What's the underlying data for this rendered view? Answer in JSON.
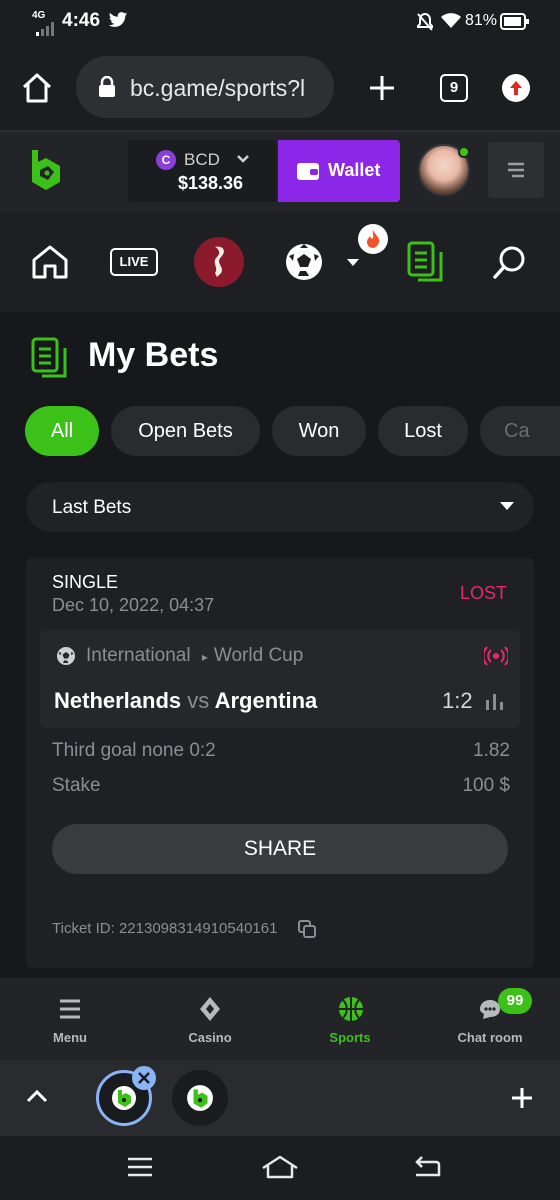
{
  "status_bar": {
    "time": "4:46",
    "network": "4G",
    "battery": "81%"
  },
  "browser": {
    "url": "bc.game/sports?l",
    "tab_count": "9"
  },
  "header": {
    "currency": "BCD",
    "balance": "$138.36",
    "wallet_label": "Wallet",
    "brand_color": "#3bc117",
    "wallet_color": "#8d27e8"
  },
  "nav_icons": [
    "home-icon",
    "live-icon",
    "world-cup-icon",
    "soccer-ball-icon",
    "chevron-down-icon",
    "fire-icon",
    "my-bets-icon",
    "search-icon"
  ],
  "nav": {
    "live_label": "LIVE"
  },
  "page": {
    "title": "My Bets"
  },
  "filters": [
    "All",
    "Open Bets",
    "Won",
    "Lost",
    "Ca"
  ],
  "dropdown": {
    "selected": "Last Bets"
  },
  "bet": {
    "type": "SINGLE",
    "date": "Dec 10, 2022, 04:37",
    "status": "LOST",
    "league": "International",
    "tournament": "World Cup",
    "home": "Netherlands",
    "vs": "vs",
    "away": "Argentina",
    "score": "1:2",
    "selection": "Third goal none  0:2",
    "odds": "1.82",
    "stake_label": "Stake",
    "stake_value": "100 $",
    "share_label": "SHARE",
    "ticket": "Ticket ID: 2213098314910540161"
  },
  "bottom_nav": {
    "items": [
      {
        "label": "Menu"
      },
      {
        "label": "Casino"
      },
      {
        "label": "Sports"
      },
      {
        "label": "Chat room"
      }
    ],
    "chat_badge": "99"
  }
}
